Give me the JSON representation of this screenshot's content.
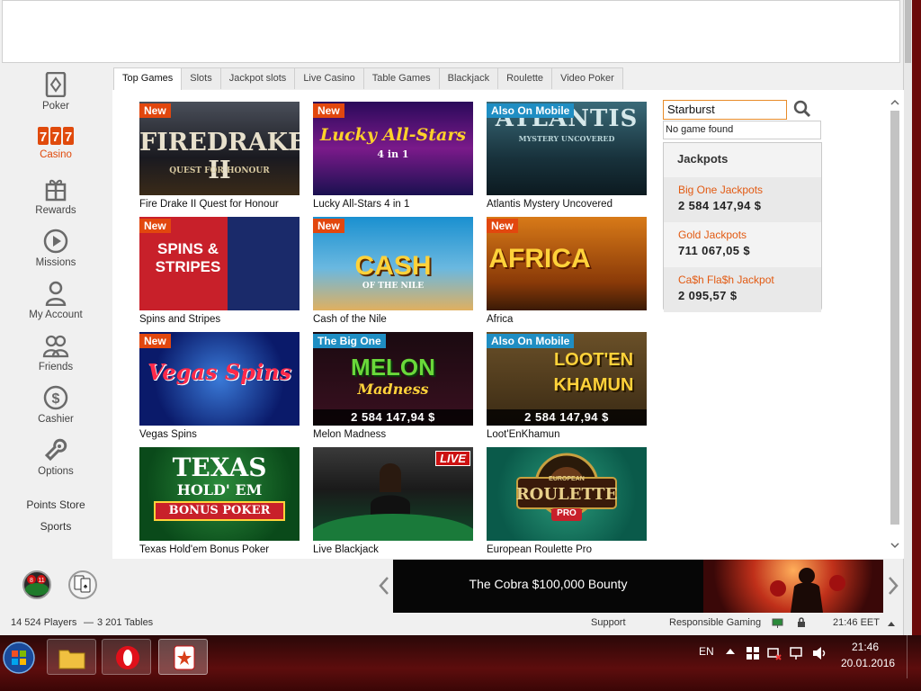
{
  "sidebar": {
    "items": [
      {
        "label": "Poker",
        "icon": "poker-icon"
      },
      {
        "label": "Casino",
        "icon": "casino-777-icon",
        "active": true
      },
      {
        "label": "Rewards",
        "icon": "gift-icon"
      },
      {
        "label": "Missions",
        "icon": "play-icon"
      },
      {
        "label": "My Account",
        "icon": "person-icon"
      },
      {
        "label": "Friends",
        "icon": "friends-icon"
      },
      {
        "label": "Cashier",
        "icon": "dollar-icon"
      },
      {
        "label": "Options",
        "icon": "wrench-icon"
      }
    ],
    "links": [
      "Points Store",
      "Sports"
    ]
  },
  "tabs": [
    "Top Games",
    "Slots",
    "Jackpot slots",
    "Live Casino",
    "Table Games",
    "Blackjack",
    "Roulette",
    "Video Poker"
  ],
  "games": [
    {
      "name": "Fire Drake II Quest for Honour",
      "badge": "New",
      "art": "FIREDRAKE II",
      "sub": "QUEST FOR HONOUR"
    },
    {
      "name": "Lucky All-Stars 4 in 1",
      "badge": "New",
      "art": "Lucky All-Stars",
      "sub": "4 in 1"
    },
    {
      "name": "Atlantis Mystery Uncovered",
      "badge": "Also On Mobile",
      "art": "ATLANTIS",
      "sub": "MYSTERY UNCOVERED"
    },
    {
      "name": "Spins and Stripes",
      "badge": "New",
      "art": "SPINS & STRIPES",
      "sub": ""
    },
    {
      "name": "Cash of the Nile",
      "badge": "New",
      "art": "CASH",
      "sub": "OF THE NILE"
    },
    {
      "name": "Africa",
      "badge": "New",
      "art": "AFRICA",
      "sub": ""
    },
    {
      "name": "Vegas Spins",
      "badge": "New",
      "art": "Vegas Spins",
      "sub": ""
    },
    {
      "name": "Melon Madness",
      "badge": "The Big One",
      "art": "MELON",
      "sub": "Madness",
      "jackpot": "2 584 147,94 $"
    },
    {
      "name": "Loot'EnKhamun",
      "badge": "Also On Mobile",
      "art": "LOOT'EN",
      "sub": "KHAMUN",
      "jackpot": "2 584 147,94 $"
    },
    {
      "name": "Texas Hold'em Bonus Poker",
      "badge": "",
      "art": "TEXAS",
      "sub": "HOLD' EM",
      "ribbon": "BONUS POKER"
    },
    {
      "name": "Live Blackjack",
      "badge": "",
      "art": "",
      "sub": "",
      "live": "LIVE"
    },
    {
      "name": "European Roulette Pro",
      "badge": "",
      "art": "ROULETTE",
      "sub": "EUROPEAN",
      "ribbon": "PRO"
    }
  ],
  "search": {
    "value": "Starburst",
    "no_result": "No game found"
  },
  "jackpots": {
    "title": "Jackpots",
    "items": [
      {
        "name": "Big One Jackpots",
        "value": "2 584 147,94 $"
      },
      {
        "name": "Gold Jackpots",
        "value": "711 067,05 $"
      },
      {
        "name": "Ca$h Fla$h Jackpot",
        "value": "2 095,57 $"
      }
    ]
  },
  "banner": {
    "text": "The Cobra $100,000 Bounty"
  },
  "status": {
    "players": "14 524 Players",
    "sep": "—",
    "tables": "3 201 Tables",
    "support": "Support",
    "responsible": "Responsible Gaming",
    "clock": "21:46 EET"
  },
  "taskbar": {
    "lang": "EN",
    "time": "21:46",
    "date": "20.01.2016"
  },
  "colors": {
    "accent": "#e25a12",
    "badge_new": "#e2470e",
    "badge_mobile": "#1f8ec3"
  }
}
